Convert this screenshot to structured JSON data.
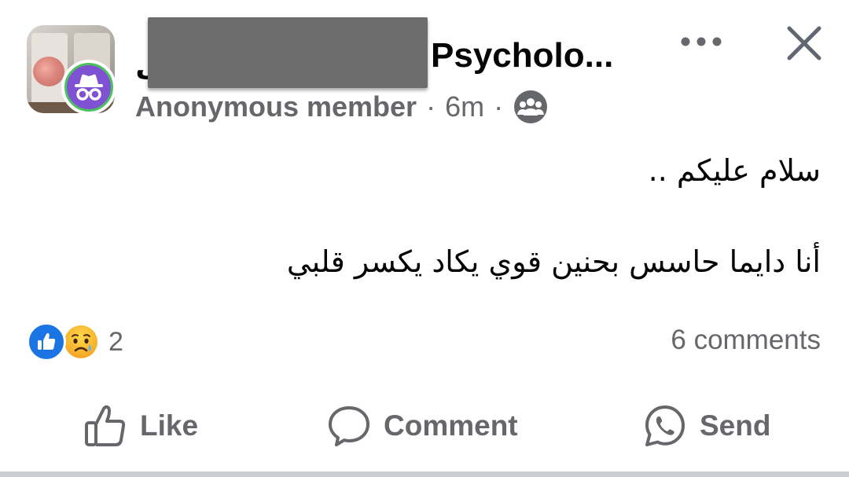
{
  "header": {
    "name_prefix": "ل",
    "group_name": "Psycholo...",
    "author": "Anonymous member",
    "separator": "·",
    "time": "6m",
    "privacy_icon": "members-group-icon",
    "more_icon": "more-horizontal-icon",
    "close_icon": "close-icon"
  },
  "post": {
    "line1": "سلام عليكم ..",
    "line2": "أنا دايما حاسس بحنين قوي يكاد يكسر قلبي"
  },
  "reactions": {
    "types": [
      "like",
      "sad"
    ],
    "count": "2",
    "like_color": "#1b74e4"
  },
  "comments": {
    "label": "6 comments"
  },
  "actions": {
    "like_label": "Like",
    "comment_label": "Comment",
    "send_label": "Send"
  },
  "colors": {
    "text_primary": "#050505",
    "text_secondary": "#65676b",
    "anon_badge_bg": "#7f51d3",
    "anon_badge_ring": "#4cc15e",
    "divider": "#c9ccd1"
  }
}
